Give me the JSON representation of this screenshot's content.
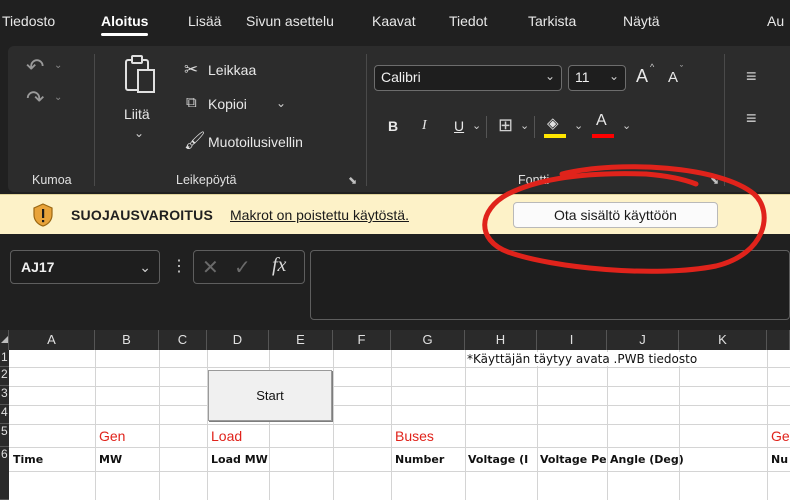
{
  "ribbon_tabs": [
    "Tiedosto",
    "Aloitus",
    "Lisää",
    "Sivun asettelu",
    "Kaavat",
    "Tiedot",
    "Tarkista",
    "Näytä",
    "Au"
  ],
  "active_tab": "Aloitus",
  "clipboard": {
    "paste_label": "Liitä",
    "cut_label": "Leikkaa",
    "copy_label": "Kopioi",
    "format_painter_label": "Muotoilusivellin",
    "group_label": "Leikepöytä"
  },
  "undo": {
    "group_label": "Kumoa"
  },
  "font": {
    "family": "Calibri",
    "size": "11",
    "group_label": "Fontti",
    "bold": "B",
    "italic": "I",
    "underline": "U",
    "grow": "A",
    "shrink": "A",
    "font_color_letter": "A"
  },
  "security_bar": {
    "title": "SUOJAUSVAROITUS",
    "message": "Makrot on poistettu käytöstä.",
    "button_label": "Ota sisältö käyttöön"
  },
  "formula_bar": {
    "name_box": "AJ17",
    "fx_label": "fx",
    "formula": ""
  },
  "sheet": {
    "columns": [
      "A",
      "B",
      "C",
      "D",
      "E",
      "F",
      "G",
      "H",
      "I",
      "J",
      "K"
    ],
    "rows": [
      "1",
      "2",
      "3",
      "4",
      "5",
      "6"
    ],
    "h1_note": "*Käyttäjän täytyy avata .PWB tiedosto",
    "start_button": "Start",
    "row5": {
      "gen": "Gen",
      "load": "Load",
      "buses": "Buses",
      "trailing": "Ge"
    },
    "row6": {
      "time": "Time",
      "mw": "MW",
      "load_mw": "Load MW",
      "number": "Number",
      "voltage_pu": "Voltage (I",
      "voltage_pe": "Voltage Pe",
      "angle": "Angle (Deg)",
      "trailing": "Nu"
    }
  },
  "colors": {
    "ribbon_bg": "#2c2c2c",
    "security_bar_bg": "#fdf2c8",
    "annotation_red": "#e0231b"
  }
}
